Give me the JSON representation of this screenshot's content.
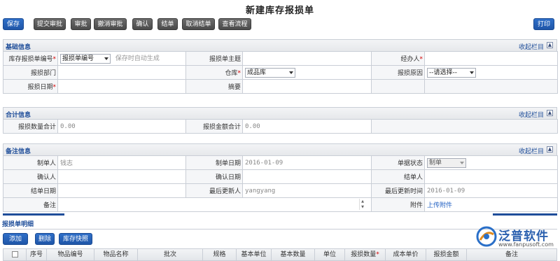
{
  "page": {
    "title": "新建库存报损单"
  },
  "toolbar": {
    "save": "保存",
    "submit": "提交审批",
    "approve": "审批",
    "revoke": "撤消审批",
    "confirm": "确认",
    "close": "结单",
    "cancel_close": "取消结单",
    "view_flow": "查看流程",
    "print": "打印"
  },
  "common": {
    "collapse": "收起栏目",
    "arrow_up": "▲",
    "arrow_down": "▼"
  },
  "basic": {
    "title": "基础信息",
    "doc_no_label": "库存报损单编号",
    "doc_no_select": "报损单编号",
    "doc_no_hint": "保存时自动生成",
    "subject_label": "报损单主题",
    "handler_label": "经办人",
    "dept_label": "报损部门",
    "warehouse_label": "仓库",
    "warehouse_value": "成品库",
    "reason_label": "报损原因",
    "reason_value": "--请选择--",
    "date_label": "报损日期",
    "summary_label": "摘要",
    "req": "*"
  },
  "totals": {
    "title": "合计信息",
    "qty_label": "报损数量合计",
    "qty_value": "0.00",
    "amount_label": "报损金额合计",
    "amount_value": "0.00"
  },
  "remarks": {
    "title": "备注信息",
    "creator_label": "制单人",
    "creator_value": "钱志",
    "create_date_label": "制单日期",
    "create_date_value": "2016-01-09",
    "status_label": "单据状态",
    "status_value": "制单",
    "confirmer_label": "确认人",
    "confirm_date_label": "确认日期",
    "closer_label": "结单人",
    "close_date_label": "结单日期",
    "last_updater_label": "最后更新人",
    "last_updater_value": "yangyang",
    "last_update_time_label": "最后更新时间",
    "last_update_time_value": "2016-01-09",
    "remark_label": "备注",
    "attach_label": "附件",
    "attach_link": "上传附件"
  },
  "detail": {
    "title": "报损单明细",
    "add": "添加",
    "delete": "删除",
    "quick": "库存快照",
    "columns": [
      "序号",
      "物品编号",
      "物品名称",
      "批次",
      "规格",
      "基本单位",
      "基本数量",
      "单位",
      "报损数量",
      "成本单价",
      "报损金额",
      "备注"
    ]
  },
  "brand": {
    "name": "泛普软件",
    "url": "www.fanpusoft.com"
  },
  "colors": {
    "accent": "#1f56a8",
    "required": "#d10000"
  }
}
